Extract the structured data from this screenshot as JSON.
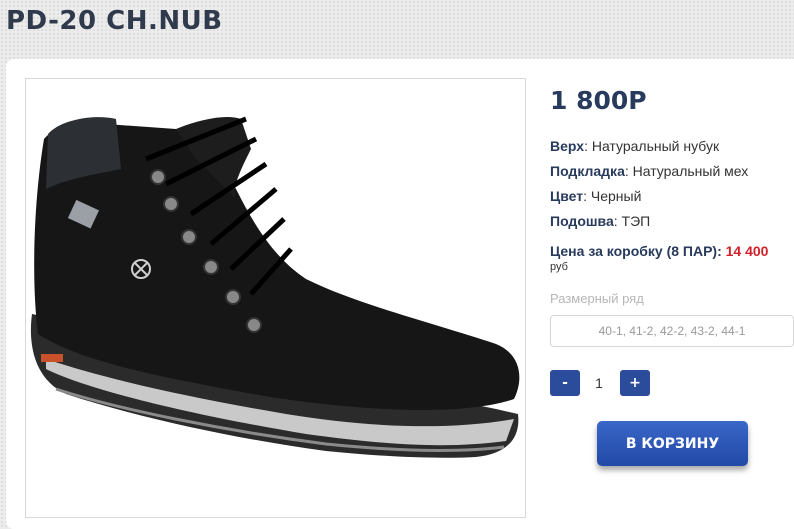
{
  "product": {
    "title": "PD-20 CH.NUB",
    "price": "1 800Р",
    "specs": [
      {
        "label": "Верх",
        "value": "Натуральный нубук"
      },
      {
        "label": "Подкладка",
        "value": "Натуральный мех"
      },
      {
        "label": "Цвет",
        "value": "Черный"
      },
      {
        "label": "Подошва",
        "value": "ТЭП"
      }
    ],
    "box_price_label": "Цена за коробку (8 ПАР):",
    "box_price_value": "14 400",
    "currency": "руб",
    "size_label": "Размерный ряд",
    "sizes": "40-1, 41-2, 42-2, 43-2, 44-1",
    "image_icon": "boot-photo"
  },
  "quantity": {
    "minus": "-",
    "value": "1",
    "plus": "+"
  },
  "cart_button": "В КОРЗИНУ",
  "colors": {
    "accent": "#2a4c9a",
    "price_red": "#d2202b",
    "heading": "#283b5c"
  }
}
